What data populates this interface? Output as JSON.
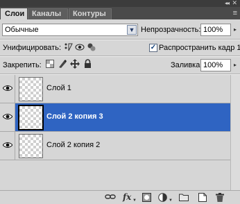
{
  "tabs": [
    {
      "label": "Слои",
      "active": true
    },
    {
      "label": "Каналы",
      "active": false
    },
    {
      "label": "Контуры",
      "active": false
    }
  ],
  "panel_buttons": {
    "collapse": "◂◂",
    "close": "✕",
    "menu": "≡"
  },
  "blend_mode": {
    "value": "Обычные"
  },
  "opacity": {
    "label": "Непрозрачность:",
    "value": "100%"
  },
  "unify": {
    "label": "Унифицировать:"
  },
  "propagate": {
    "label": "Распространить кадр 1",
    "checked": true
  },
  "lock": {
    "label": "Закрепить:"
  },
  "fill": {
    "label": "Заливка:",
    "value": "100%"
  },
  "layers": [
    {
      "name": "Слой 1",
      "selected": false,
      "visible": true
    },
    {
      "name": "Слой 2 копия 3",
      "selected": true,
      "visible": true
    },
    {
      "name": "Слой 2 копия 2",
      "selected": false,
      "visible": true
    }
  ],
  "footer": {
    "fx": "fx"
  },
  "colors": {
    "selection": "#2f64c2",
    "panel_bg": "#d6d6d6",
    "tab_bg": "#4a4a4a"
  }
}
